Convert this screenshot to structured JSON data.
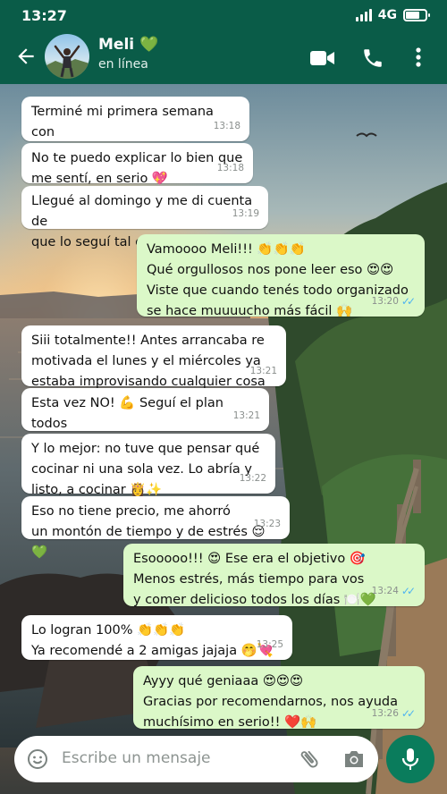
{
  "status_bar": {
    "time": "13:27",
    "network": "4G"
  },
  "header": {
    "name": "Meli 💚",
    "status": "en línea",
    "icons": [
      "back-arrow-icon",
      "video-call-icon",
      "phone-icon",
      "more-vert-icon"
    ]
  },
  "messages": [
    {
      "dir": "in",
      "text": "Terminé mi primera semana con\nel métodoooo 🙌",
      "time": "13:18"
    },
    {
      "dir": "in",
      "text": "No te puedo explicar lo bien que\nme sentí, en serio 💖",
      "time": "13:18"
    },
    {
      "dir": "in",
      "text": "Llegué al domingo y me di cuenta de\nque lo seguí tal cual 🙈😅",
      "time": "13:19"
    },
    {
      "dir": "out",
      "text": "Vamoooo Meli!!! 👏👏👏\nQué orgullosos nos pone leer eso 😍😍\nViste que cuando tenés todo organizado\nse hace muuuucho más fácil 🙌",
      "time": "13:20"
    },
    {
      "dir": "in",
      "text": "Siii totalmente!! Antes arrancaba re\nmotivada el lunes y el miércoles ya\nestaba improvisando cualquier cosa😅",
      "time": "13:21"
    },
    {
      "dir": "in",
      "text": "Esta vez NO! 💪 Seguí el plan todos\nlos días y comí riquísimo 😊",
      "time": "13:21"
    },
    {
      "dir": "in",
      "text": "Y lo mejor: no tuve que pensar qué\ncocinar ni una sola vez. Lo abría y\nlisto, a cocinar 👸✨",
      "time": "13:22"
    },
    {
      "dir": "in",
      "text": "Eso no tiene precio, me ahorró\nun montón de tiempo y de estrés 😌💚",
      "time": "13:23"
    },
    {
      "dir": "out",
      "text": "Esooooo!!! 😍 Ese era el objetivo 🎯\nMenos estrés, más tiempo para vos\ny comer delicioso todos los días 🍽️💚",
      "time": "13:24"
    },
    {
      "dir": "in",
      "text": "Lo logran 100% 👏👏👏\nYa recomendé a 2 amigas jajaja 🤭💘",
      "time": "13:25"
    },
    {
      "dir": "out",
      "text": "Ayyy qué geniaaa 😍😍😍\nGracias por recomendarnos, nos ayuda\nmuchísimo en serio!! ❤️🙌",
      "time": "13:26"
    }
  ],
  "composer": {
    "placeholder": "Escribe un mensaje",
    "icons": [
      "emoji-icon",
      "attach-icon",
      "camera-icon",
      "mic-icon"
    ]
  },
  "colors": {
    "header": "#0a5c48",
    "incoming": "#ffffff",
    "outgoing": "#dbf8c8",
    "send_button": "#0a7c5c",
    "read_ticks": "#4fb4f0"
  }
}
